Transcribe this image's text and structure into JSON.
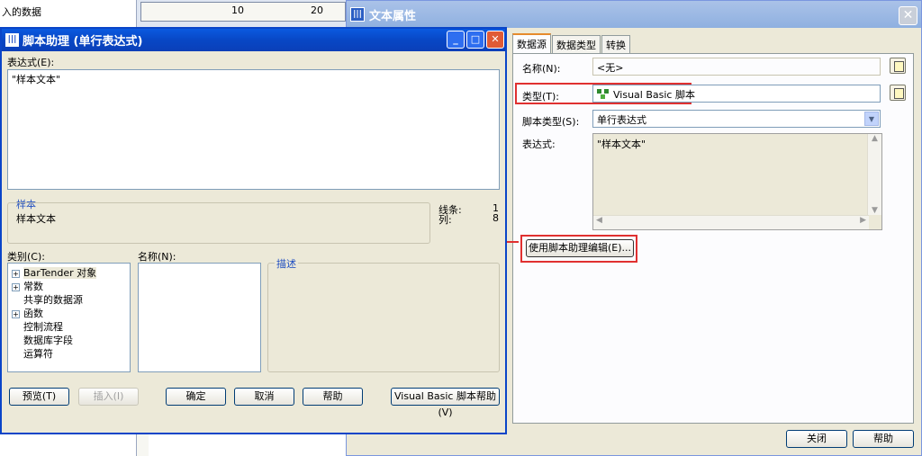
{
  "background": {
    "left_text": "入的数据",
    "ruler_numbers": [
      "10",
      "20"
    ]
  },
  "properties_window": {
    "title": "文本属性",
    "tabs": [
      "数据源",
      "数据类型",
      "转换"
    ],
    "name_label": "名称(N):",
    "name_value": "<无>",
    "type_label": "类型(T):",
    "type_value": "Visual Basic 脚本",
    "script_type_label": "脚本类型(S):",
    "script_type_value": "单行表达式",
    "expression_label": "表达式:",
    "expression_value": "\"样本文本\"",
    "use_helper_button": "使用脚本助理编辑(E)...",
    "close_button": "关闭",
    "help_button": "帮助",
    "highlight_color": "#e03030"
  },
  "helper_window": {
    "title": "脚本助理 (单行表达式)",
    "expression_label": "表达式(E):",
    "expression_value": "\"样本文本\"",
    "sample_group": "样本",
    "sample_value": "样本文本",
    "line_label": "线条:",
    "line_value": "1",
    "col_label": "列:",
    "col_value": "8",
    "category_label": "类别(C):",
    "categories": [
      {
        "label": "BarTender 对象",
        "expandable": true
      },
      {
        "label": "常数",
        "expandable": true
      },
      {
        "label": "共享的数据源",
        "expandable": false
      },
      {
        "label": "函数",
        "expandable": true
      },
      {
        "label": "控制流程",
        "expandable": false
      },
      {
        "label": "数据库字段",
        "expandable": false
      },
      {
        "label": "运算符",
        "expandable": false
      }
    ],
    "name_label": "名称(N):",
    "description_group": "描述",
    "buttons": {
      "preview": "预览(T)",
      "insert": "插入(I)",
      "ok": "确定",
      "cancel": "取消",
      "help": "帮助",
      "vb_help": "Visual Basic 脚本帮助(V)"
    }
  }
}
